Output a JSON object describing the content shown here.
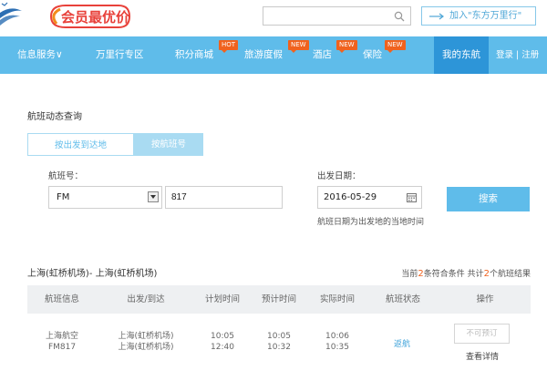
{
  "header": {
    "promo_logo": "会员最优价",
    "search": {
      "value": "",
      "placeholder": ""
    },
    "add_partner_label": "加入\"东方万里行\""
  },
  "nav": {
    "items": [
      {
        "label": "信息服务∨",
        "badge": ""
      },
      {
        "label": "万里行专区",
        "badge": ""
      },
      {
        "label": "积分商城",
        "badge": "HOT"
      },
      {
        "label": "旅游度假",
        "badge": "NEW"
      },
      {
        "label": "酒店",
        "badge": "NEW"
      },
      {
        "label": "保险",
        "badge": "NEW"
      }
    ],
    "my_account": "我的东航",
    "login": "登录",
    "divider": "|",
    "register": "注册"
  },
  "query": {
    "title": "航班动态查询",
    "tabs": [
      {
        "label": "按出发到达地",
        "active": false
      },
      {
        "label": "按航班号",
        "active": true
      }
    ],
    "flight_label": "航班号：",
    "airline_code": "FM",
    "flight_number": "817",
    "date_label": "出发日期：",
    "date_value": "2016-05-29",
    "date_hint": "航班日期为出发地的当地时间",
    "search_button": "搜索"
  },
  "results": {
    "route_title": "上海(虹桥机场)- 上海(虹桥机场)",
    "summary": {
      "prefix": "当前",
      "matched": "2",
      "middle": "条符合条件 共计",
      "total": "2",
      "suffix": "个航班结果"
    },
    "columns": [
      "航班信息",
      "出发/到达",
      "计划时间",
      "预计时间",
      "实际时间",
      "航班状态",
      "操作"
    ],
    "rows": [
      {
        "airline": "上海航空",
        "flight": "FM817",
        "departure": "上海(虹桥机场)",
        "arrival": "上海(虹桥机场)",
        "planned_dep": "10:05",
        "planned_arr": "12:40",
        "estimated_dep": "10:05",
        "estimated_arr": "10:32",
        "actual_dep": "10:06",
        "actual_arr": "10:35",
        "status": "返航",
        "action_disabled": "不可预订",
        "action_detail": "查看详情"
      }
    ]
  },
  "colors": {
    "nav_bg": "#5fbcea",
    "nav_active": "#2d95d8",
    "badge": "#f0621e",
    "accent_count": "#f0621e",
    "status_link": "#3ba1d9"
  }
}
